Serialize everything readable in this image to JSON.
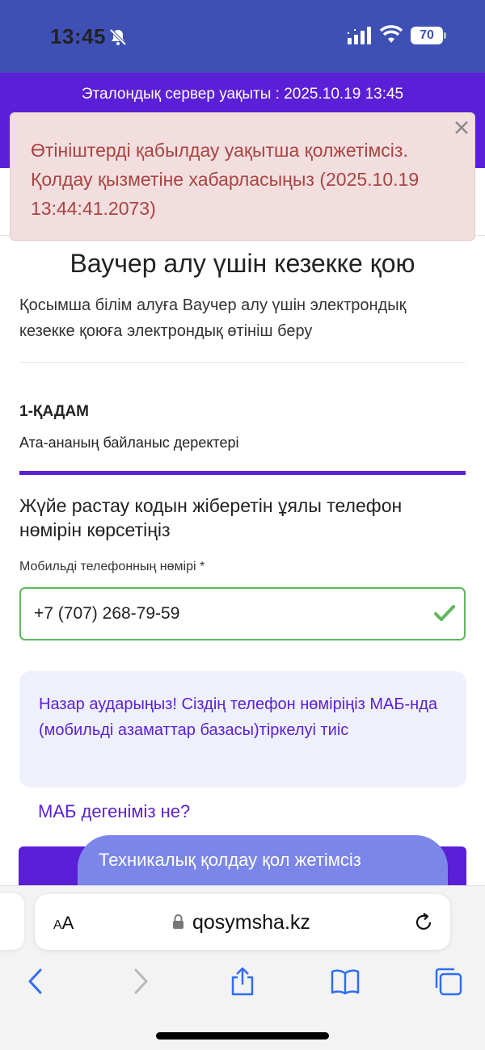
{
  "status_bar": {
    "time": "13:45",
    "battery": "70",
    "icons": [
      "bell-slash-icon",
      "cellular-signal-icon",
      "wifi-icon",
      "battery-icon"
    ]
  },
  "header": {
    "server_time": "Эталондық сервер уақыты : 2025.10.19 13:45"
  },
  "alert": {
    "message": "Өтініштерді қабылдау уақытша қолжетімсіз. Қолдау қызметіне хабарласыңыз (2025.10.19 13:44:41.2073)",
    "close_icon": "close-icon",
    "color": "#a94442"
  },
  "page": {
    "title": "Ваучер алу үшін кезекке қою",
    "subtitle": "Қосымша білім алуға Ваучер алу үшін электрондық кезекке қоюға электрондық өтініш беру"
  },
  "step": {
    "label": "1-ҚАДАМ",
    "description": "Ата-ананың байланыс деректері"
  },
  "form": {
    "heading": "Жүйе растау кодын жіберетін ұялы телефон нөмірін көрсетіңіз",
    "phone_label": "Мобильді телефонның нөмірі *",
    "phone_value": "+7 (707) 268-79-59",
    "valid_color": "#5cb85c"
  },
  "notice": {
    "text": "Назар аударыңыз! Сіздің телефон нөміріңіз МАБ-нда (мобильді азаматтар базасы)тіркелуі тиіс",
    "link": "МАБ дегеніміз не?"
  },
  "support_toast": {
    "text": "Техникалық қолдау қол жетімсіз"
  },
  "browser": {
    "aa_label_small": "A",
    "aa_label_large": "A",
    "url": "qosymsha.kz",
    "nav_icons": [
      "back-icon",
      "forward-icon",
      "share-icon",
      "bookmarks-icon",
      "tabs-icon"
    ]
  },
  "colors": {
    "accent": "#5a1fd6",
    "status_bar": "#3f50b5",
    "notice_bg": "#eef1fb"
  }
}
